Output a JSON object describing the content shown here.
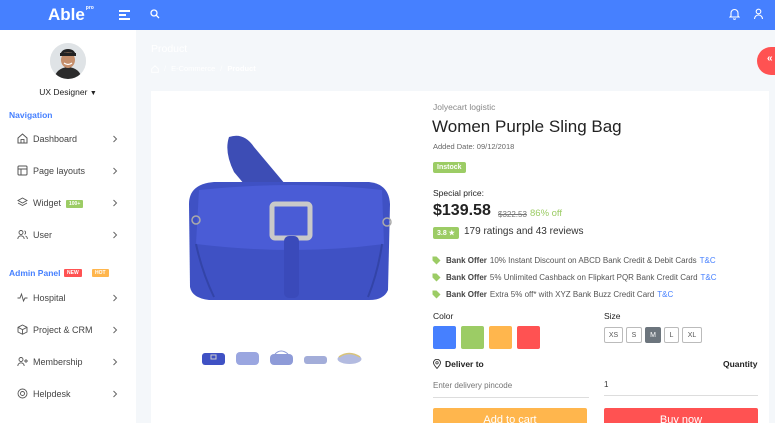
{
  "brand": {
    "name": "Able",
    "badge": "pro"
  },
  "user": {
    "name": "UX Designer"
  },
  "sidebar": {
    "navigation_label": "Navigation",
    "nav_items": [
      {
        "label": "Dashboard",
        "icon": "home-icon"
      },
      {
        "label": "Page layouts",
        "icon": "layout-icon"
      },
      {
        "label": "Widget",
        "icon": "layers-icon",
        "badge": "100+"
      },
      {
        "label": "User",
        "icon": "users-icon"
      }
    ],
    "admin_label": "Admin Panel",
    "admin_badges": [
      "NEW",
      "HOT"
    ],
    "admin_items": [
      {
        "label": "Hospital",
        "icon": "activity-icon"
      },
      {
        "label": "Project & CRM",
        "icon": "box-icon"
      },
      {
        "label": "Membership",
        "icon": "user-plus-icon"
      },
      {
        "label": "Helpdesk",
        "icon": "help-circle-icon"
      }
    ]
  },
  "page": {
    "title": "Product",
    "breadcrumb": [
      "E-Commerce",
      "Product"
    ]
  },
  "product": {
    "store": "Jolyecart logistic",
    "name": "Women Purple Sling Bag",
    "added_date": "Added Date: 09/12/2018",
    "stock_status": "Instock",
    "special_price_label": "Special price:",
    "price": "$139.58",
    "old_price": "$322.53",
    "discount": "86% off",
    "rating": "3.8 ★",
    "ratings_text": "179 ratings and 43 reviews",
    "offers": [
      {
        "title": "Bank Offer",
        "text": "10% Instant Discount on ABCD Bank Credit & Debit Cards",
        "link": "T&C"
      },
      {
        "title": "Bank Offer",
        "text": "5% Unlimited Cashback on Flipkart PQR Bank Credit Card",
        "link": "T&C"
      },
      {
        "title": "Bank Offer",
        "text": "Extra 5% off* with XYZ Bank Buzz Credit Card",
        "link": "T&C"
      }
    ],
    "color_label": "Color",
    "colors": [
      "#4680ff",
      "#9ccc65",
      "#ffb64d",
      "#ff5252"
    ],
    "size_label": "Size",
    "sizes": [
      "XS",
      "S",
      "M",
      "L",
      "XL"
    ],
    "selected_size": "M",
    "deliver_label": "Deliver to",
    "pincode_placeholder": "Enter delivery pincode",
    "quantity_label": "Quantity",
    "quantity_value": "1",
    "add_to_cart": "Add to cart",
    "buy_now": "Buy now"
  },
  "colors": {
    "primary": "#4680ff",
    "success": "#9ccc65",
    "warning": "#ffb64d",
    "danger": "#ff5252"
  }
}
